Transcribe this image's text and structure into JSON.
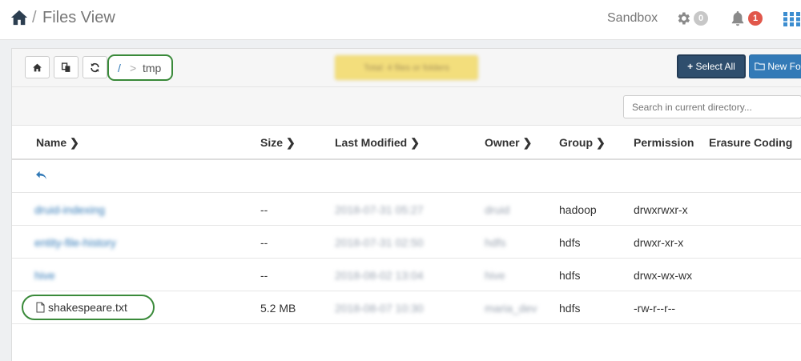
{
  "header": {
    "title": "Files View",
    "separator": "/",
    "sandbox": "Sandbox",
    "settings_count": "0",
    "alerts_count": "1"
  },
  "toolbar": {
    "breadcrumb_root": "/",
    "breadcrumb_sep": ">",
    "breadcrumb_current": "tmp",
    "obscured_button": "Total: 4 files or folders",
    "select_all": "Select All",
    "new_folder": "New Folder"
  },
  "search": {
    "placeholder": "Search in current directory..."
  },
  "columns": {
    "name": "Name",
    "size": "Size",
    "modified": "Last Modified",
    "owner": "Owner",
    "group": "Group",
    "permission": "Permission",
    "erasure": "Erasure Coding"
  },
  "rows": [
    {
      "name": "druid-indexing",
      "size": "--",
      "modified": "2018-07-31 05:27",
      "owner": "druid",
      "group": "hadoop",
      "permission": "drwxrwxr-x"
    },
    {
      "name": "entity-file-history",
      "size": "--",
      "modified": "2018-07-31 02:50",
      "owner": "hdfs",
      "group": "hdfs",
      "permission": "drwxr-xr-x"
    },
    {
      "name": "hive",
      "size": "--",
      "modified": "2018-08-02 13:04",
      "owner": "hive",
      "group": "hdfs",
      "permission": "drwx-wx-wx"
    },
    {
      "name": "shakespeare.txt",
      "size": "5.2 MB",
      "modified": "2018-08-07 10:30",
      "owner": "maria_dev",
      "group": "hdfs",
      "permission": "-rw-r--r--"
    }
  ],
  "colors": {
    "accent": "#337ab7",
    "highlight": "#3a8a3a",
    "select_all": "#2f4e6d",
    "alert": "#e1574b"
  }
}
